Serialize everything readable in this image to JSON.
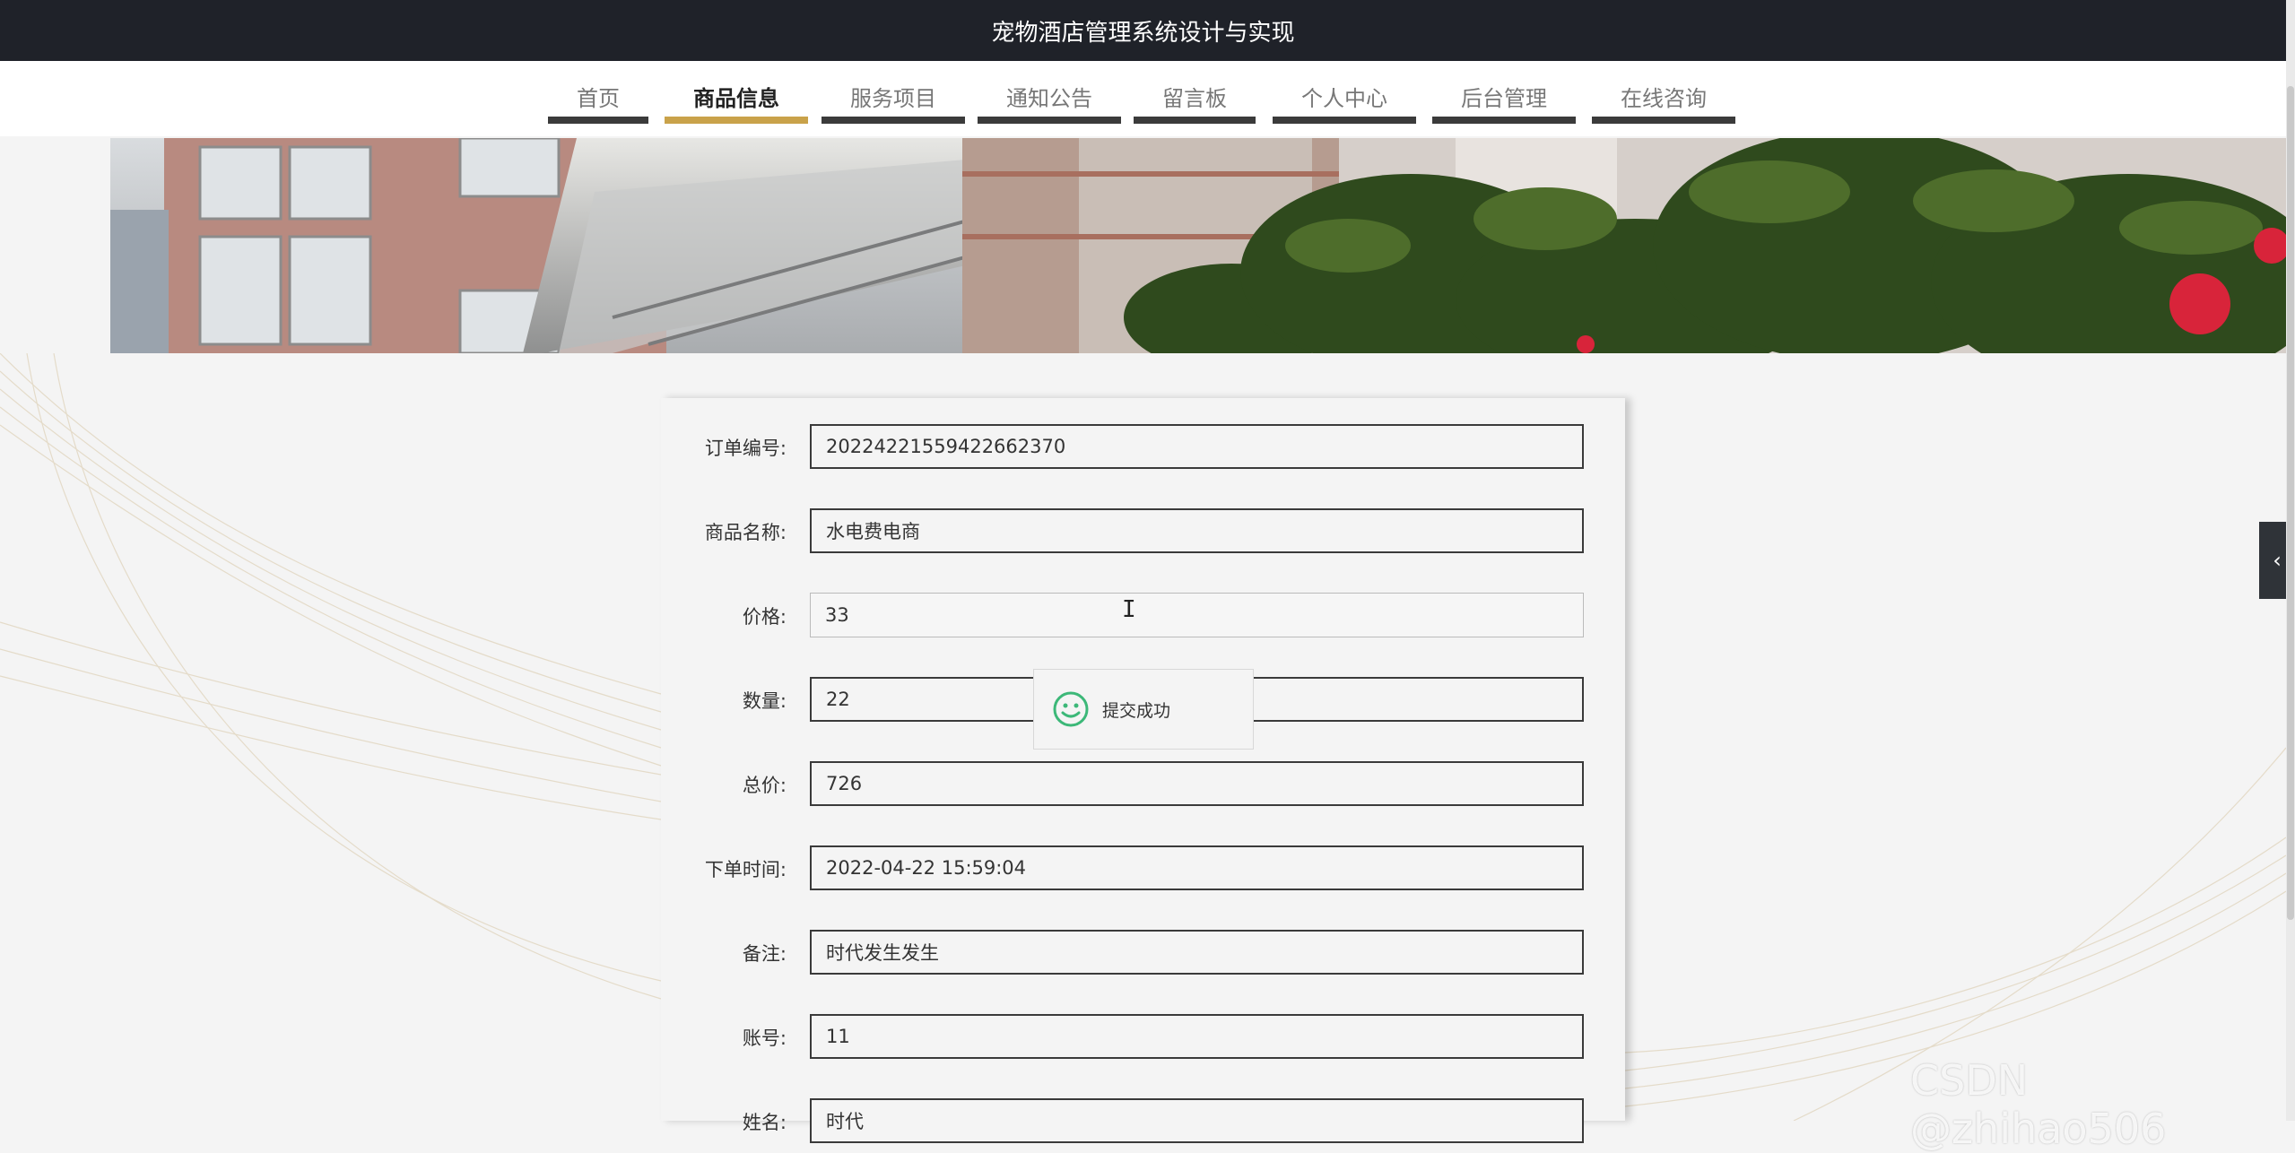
{
  "app": {
    "title": "宠物酒店管理系统设计与实现"
  },
  "nav": {
    "items": [
      {
        "label": "首页",
        "active": false
      },
      {
        "label": "商品信息",
        "active": true
      },
      {
        "label": "服务项目",
        "active": false
      },
      {
        "label": "通知公告",
        "active": false
      },
      {
        "label": "留言板",
        "active": false
      },
      {
        "label": "个人中心",
        "active": false
      },
      {
        "label": "后台管理",
        "active": false
      },
      {
        "label": "在线咨询",
        "active": false
      }
    ]
  },
  "form": {
    "fields": [
      {
        "label": "订单编号:",
        "value": "20224221559422662370"
      },
      {
        "label": "商品名称:",
        "value": "水电费电商"
      },
      {
        "label": "价格:",
        "value": "33"
      },
      {
        "label": "数量:",
        "value": "22"
      },
      {
        "label": "总价:",
        "value": "726"
      },
      {
        "label": "下单时间:",
        "value": "2022-04-22 15:59:04"
      },
      {
        "label": "备注:",
        "value": "时代发生发生"
      },
      {
        "label": "账号:",
        "value": "11"
      },
      {
        "label": "姓名:",
        "value": "时代"
      }
    ]
  },
  "toast": {
    "message": "提交成功",
    "icon": "smile-icon"
  },
  "side_tab": {
    "icon": "chevron-left-icon"
  },
  "watermark": "CSDN @zhihao506",
  "colors": {
    "topbar": "#1f2229",
    "active_underline": "#c9a24a",
    "underline": "#3b3b3b",
    "toast_icon": "#3cb878"
  }
}
